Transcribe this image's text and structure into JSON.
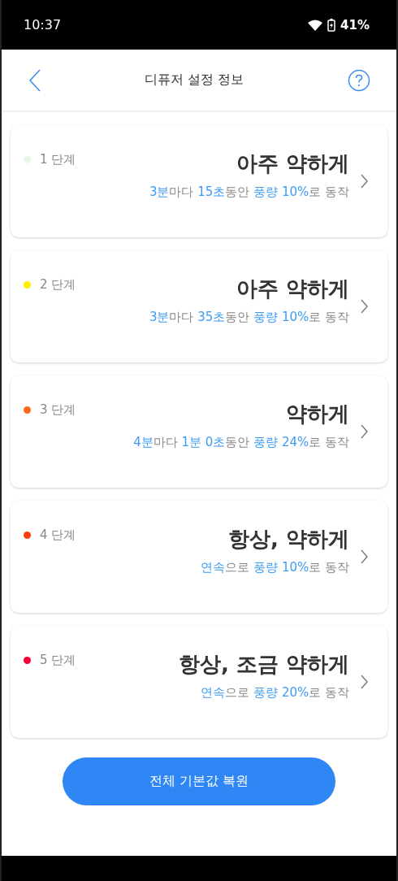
{
  "status_bar": {
    "time": "10:37",
    "battery": "41%"
  },
  "header": {
    "title": "디퓨저 설정 정보"
  },
  "levels": [
    {
      "label": "1 단계",
      "color": "#e6f9e6",
      "title": "아주 약하게",
      "description": [
        {
          "text": "3분",
          "highlight": true
        },
        {
          "text": "마다 ",
          "highlight": false
        },
        {
          "text": "15초",
          "highlight": true
        },
        {
          "text": "동안 ",
          "highlight": false
        },
        {
          "text": "풍량 10%",
          "highlight": true
        },
        {
          "text": "로 동작",
          "highlight": false
        }
      ]
    },
    {
      "label": "2 단계",
      "color": "#ffee00",
      "title": "아주 약하게",
      "description": [
        {
          "text": "3분",
          "highlight": true
        },
        {
          "text": "마다 ",
          "highlight": false
        },
        {
          "text": "35초",
          "highlight": true
        },
        {
          "text": "동안 ",
          "highlight": false
        },
        {
          "text": "풍량 10%",
          "highlight": true
        },
        {
          "text": "로 동작",
          "highlight": false
        }
      ]
    },
    {
      "label": "3 단계",
      "color": "#ff6a1a",
      "title": "약하게",
      "description": [
        {
          "text": "4분",
          "highlight": true
        },
        {
          "text": "마다 ",
          "highlight": false
        },
        {
          "text": "1분 0초",
          "highlight": true
        },
        {
          "text": "동안 ",
          "highlight": false
        },
        {
          "text": "풍량 24%",
          "highlight": true
        },
        {
          "text": "로 동작",
          "highlight": false
        }
      ]
    },
    {
      "label": "4 단계",
      "color": "#ff3d0a",
      "title": "항상, 약하게",
      "description": [
        {
          "text": "연속",
          "highlight": true
        },
        {
          "text": "으로 ",
          "highlight": false
        },
        {
          "text": "풍량 10%",
          "highlight": true
        },
        {
          "text": "로 동작",
          "highlight": false
        }
      ]
    },
    {
      "label": "5 단계",
      "color": "#f5003d",
      "title": "항상, 조금 약하게",
      "description": [
        {
          "text": "연속",
          "highlight": true
        },
        {
          "text": "으로 ",
          "highlight": false
        },
        {
          "text": "풍량 20%",
          "highlight": true
        },
        {
          "text": "로 동작",
          "highlight": false
        }
      ]
    }
  ],
  "reset_button": "전체 기본값 복원"
}
